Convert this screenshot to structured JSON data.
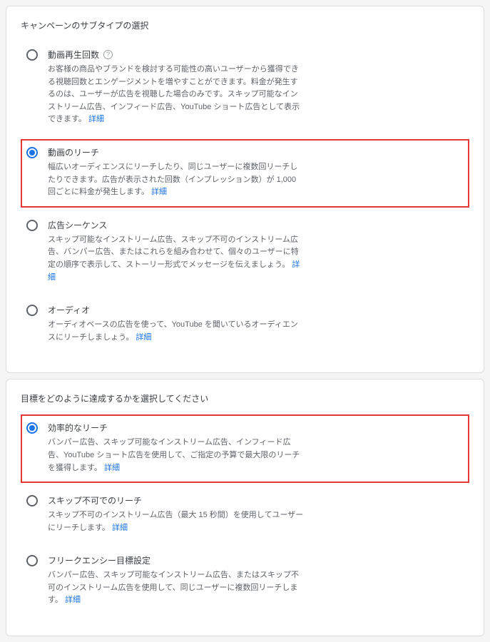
{
  "cards": [
    {
      "title": "キャンペーンのサブタイプの選択",
      "options": [
        {
          "id": "video-views",
          "label": "動画再生回数",
          "help": true,
          "selected": false,
          "highlight": false,
          "desc": "お客様の商品やブランドを検討する可能性の高いユーザーから獲得できる視聴回数とエンゲージメントを増やすことができます。料金が発生するのは、ユーザーが広告を視聴した場合のみです。スキップ可能なインストリーム広告、インフィード広告、YouTube ショート広告として表示できます。",
          "link": "詳細"
        },
        {
          "id": "video-reach",
          "label": "動画のリーチ",
          "help": false,
          "selected": true,
          "highlight": true,
          "desc": "幅広いオーディエンスにリーチしたり、同じユーザーに複数回リーチしたりできます。広告が表示された回数（インプレッション数）が 1,000 回ごとに料金が発生します。",
          "link": "詳細"
        },
        {
          "id": "ad-sequence",
          "label": "広告シーケンス",
          "help": false,
          "selected": false,
          "highlight": false,
          "desc": "スキップ可能なインストリーム広告、スキップ不可のインストリーム広告、バンパー広告、またはこれらを組み合わせて、個々のユーザーに特定の順序で表示して、ストーリー形式でメッセージを伝えましょう。",
          "link": "詳細"
        },
        {
          "id": "audio",
          "label": "オーディオ",
          "help": false,
          "selected": false,
          "highlight": false,
          "desc": "オーディオベースの広告を使って、YouTube を聞いているオーディエンスにリーチしましょう。",
          "link": "詳細"
        }
      ]
    },
    {
      "title": "目標をどのように達成するかを選択してください",
      "options": [
        {
          "id": "efficient-reach",
          "label": "効率的なリーチ",
          "help": false,
          "selected": true,
          "highlight": true,
          "desc": "バンパー広告、スキップ可能なインストリーム広告、インフィード広告、YouTube ショート広告を使用して、ご指定の予算で最大限のリーチを獲得します。",
          "link": "詳細"
        },
        {
          "id": "non-skippable-reach",
          "label": "スキップ不可でのリーチ",
          "help": false,
          "selected": false,
          "highlight": false,
          "desc": "スキップ不可のインストリーム広告（最大 15 秒間）を使用してユーザーにリーチします。",
          "link": "詳細"
        },
        {
          "id": "frequency-goal",
          "label": "フリークエンシー目標設定",
          "help": false,
          "selected": false,
          "highlight": false,
          "desc": "バンパー広告、スキップ可能なインストリーム広告、またはスキップ不可のインストリーム広告を使用して、同じユーザーに複数回リーチします。",
          "link": "詳細"
        }
      ]
    }
  ]
}
